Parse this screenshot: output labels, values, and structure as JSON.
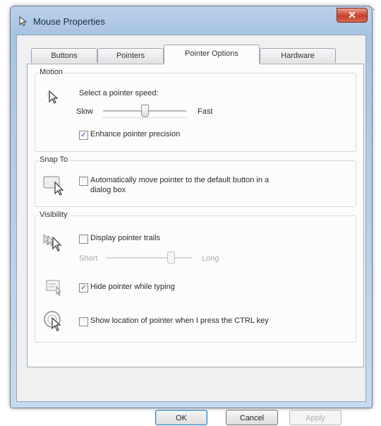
{
  "window": {
    "title": "Mouse Properties",
    "close_label": "✕"
  },
  "tabs": [
    {
      "label": "Buttons"
    },
    {
      "label": "Pointers"
    },
    {
      "label": "Pointer Options",
      "active": true
    },
    {
      "label": "Hardware"
    }
  ],
  "motion": {
    "group_title": "Motion",
    "prompt": "Select a pointer speed:",
    "slow_label": "Slow",
    "fast_label": "Fast",
    "speed_level": 0.5,
    "enhance_label": "Enhance pointer precision",
    "enhance_checked": true
  },
  "snap_to": {
    "group_title": "Snap To",
    "label_line1": "Automatically move pointer to the default button in a",
    "label_line2": "dialog box",
    "checked": false
  },
  "visibility": {
    "group_title": "Visibility",
    "trails_label": "Display pointer trails",
    "trails_checked": false,
    "short_label": "Short",
    "long_label": "Long",
    "trails_level": 0.75,
    "hide_label": "Hide pointer while typing",
    "hide_checked": true,
    "ctrl_label": "Show location of pointer when I press the CTRL key",
    "ctrl_checked": false
  },
  "buttons": {
    "ok": "OK",
    "cancel": "Cancel",
    "apply": "Apply"
  },
  "colors": {
    "accent": "#3c7fb1",
    "titlebar": "#b9d1ea",
    "close": "#c7402a"
  }
}
